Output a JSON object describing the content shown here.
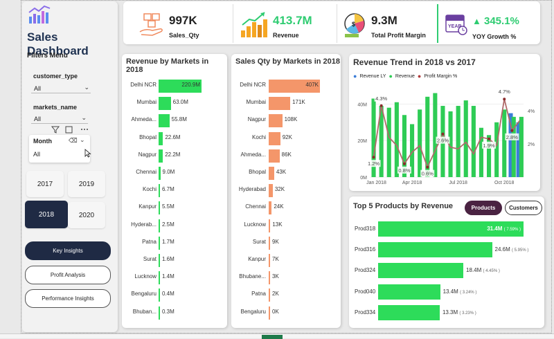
{
  "sidebar": {
    "title": "Sales Dashboard",
    "filters_menu": "Filters Menu",
    "filters": [
      {
        "label": "customer_type",
        "value": "All"
      },
      {
        "label": "markets_name",
        "value": "All"
      },
      {
        "label": "Month",
        "value": "All"
      }
    ],
    "years": [
      {
        "label": "2017",
        "selected": false
      },
      {
        "label": "2019",
        "selected": false
      },
      {
        "label": "2018",
        "selected": true
      },
      {
        "label": "2020",
        "selected": false
      }
    ],
    "nav": [
      {
        "label": "Key Insights",
        "active": true
      },
      {
        "label": "Profit Analysis",
        "active": false
      },
      {
        "label": "Performance Insights",
        "active": false
      }
    ]
  },
  "kpis": [
    {
      "value": "997K",
      "label": "Sales_Qty",
      "color": "#f08a5d",
      "icon": "hand-boxes-icon"
    },
    {
      "value": "413.7M",
      "label": "Revenue",
      "color": "#2ecc71",
      "icon": "money-growth-icon"
    },
    {
      "value": "9.3M",
      "label": "Total Profit Margin",
      "color": "#222222",
      "icon": "pie-money-icon"
    },
    {
      "value": "345.1%",
      "label": "YOY Growth %",
      "color": "#2ecc71",
      "icon": "calendar-year-icon",
      "arrow": "▲"
    }
  ],
  "revenue_markets": {
    "title": "Revenue by Markets in 2018",
    "color": "#2ddc5a",
    "chart_data": {
      "type": "bar",
      "categories": [
        "Delhi NCR",
        "Mumbai",
        "Ahmeda...",
        "Bhopal",
        "Nagpur",
        "Chennai",
        "Kochi",
        "Kanpur",
        "Hyderab...",
        "Patna",
        "Surat",
        "Lucknow",
        "Bengaluru",
        "Bhuban..."
      ],
      "values": [
        220.9,
        63.0,
        55.8,
        22.6,
        22.2,
        9.0,
        6.7,
        5.5,
        2.5,
        1.7,
        1.6,
        1.4,
        0.4,
        0.3
      ],
      "labels": [
        "220.9M",
        "63.0M",
        "55.8M",
        "22.6M",
        "22.2M",
        "9.0M",
        "6.7M",
        "5.5M",
        "2.5M",
        "1.7M",
        "1.6M",
        "1.4M",
        "0.4M",
        "0.3M"
      ]
    }
  },
  "qty_markets": {
    "title": "Sales Qty by Markets in 2018",
    "color": "#f4966a",
    "chart_data": {
      "type": "bar",
      "categories": [
        "Delhi NCR",
        "Mumbai",
        "Nagpur",
        "Kochi",
        "Ahmeda...",
        "Bhopal",
        "Hyderabad",
        "Chennai",
        "Lucknow",
        "Surat",
        "Kanpur",
        "Bhubane...",
        "Patna",
        "Bengaluru"
      ],
      "values": [
        407,
        171,
        108,
        92,
        86,
        43,
        32,
        24,
        13,
        9,
        7,
        3,
        2,
        0
      ],
      "labels": [
        "407K",
        "171K",
        "108K",
        "92K",
        "86K",
        "43K",
        "32K",
        "24K",
        "13K",
        "9K",
        "7K",
        "3K",
        "2K",
        "0K"
      ]
    }
  },
  "trend": {
    "title": "Revenue Trend in 2018 vs 2017",
    "legend": [
      "Revenue LY",
      "Revenue",
      "Profit Margin %"
    ],
    "colors": {
      "ly": "#3b7dd8",
      "rev": "#2ecc55",
      "pm": "#b06a6a"
    },
    "y_ticks": [
      "0M",
      "20M",
      "40M"
    ],
    "y2_ticks": [
      "2%",
      "4%"
    ],
    "x_ticks": [
      "Jan 2018",
      "Apr 2018",
      "Jul 2018",
      "Oct 2018"
    ],
    "chart_data": {
      "type": "bar",
      "revenue_ly": [
        0,
        0,
        0,
        0,
        0,
        0,
        0,
        0,
        0,
        0,
        0,
        0,
        0,
        0,
        0,
        0,
        0,
        0,
        35,
        30
      ],
      "revenue": [
        43,
        39,
        38,
        41,
        34,
        29,
        37,
        44,
        46,
        39,
        36,
        39,
        42,
        39,
        27,
        23,
        30,
        37,
        33,
        33
      ],
      "profit_margin": [
        1.2,
        4.3,
        2.4,
        1.9,
        0.8,
        1.5,
        1.9,
        0.6,
        1.6,
        2.6,
        1.8,
        1.7,
        2.1,
        1.4,
        2.4,
        2.3,
        1.9,
        4.7,
        2.8,
        3.4
      ],
      "annotations": [
        {
          "i": 0,
          "text": "1.2%"
        },
        {
          "i": 1,
          "text": "4.3%"
        },
        {
          "i": 4,
          "text": "0.8%"
        },
        {
          "i": 7,
          "text": "0.6%"
        },
        {
          "i": 9,
          "text": "2.6%"
        },
        {
          "i": 15,
          "text": "1.9%"
        },
        {
          "i": 17,
          "text": "4.7%"
        },
        {
          "i": 18,
          "text": "2.8%"
        }
      ]
    }
  },
  "top_products": {
    "title": "Top 5 Products by Revenue",
    "toggle_products": "Products",
    "toggle_customers": "Customers",
    "color": "#2ddc5a",
    "chart_data": {
      "type": "bar",
      "categories": [
        "Prod318",
        "Prod316",
        "Prod324",
        "Prod040",
        "Prod334"
      ],
      "values": [
        31.4,
        24.6,
        18.4,
        13.4,
        13.3
      ],
      "labels": [
        "31.4M",
        "24.6M",
        "18.4M",
        "13.4M",
        "13.3M"
      ],
      "pct": [
        "( 7.59% )",
        "( 5.95% )",
        "( 4.45% )",
        "( 3.24% )",
        "( 3.23% )"
      ]
    }
  }
}
